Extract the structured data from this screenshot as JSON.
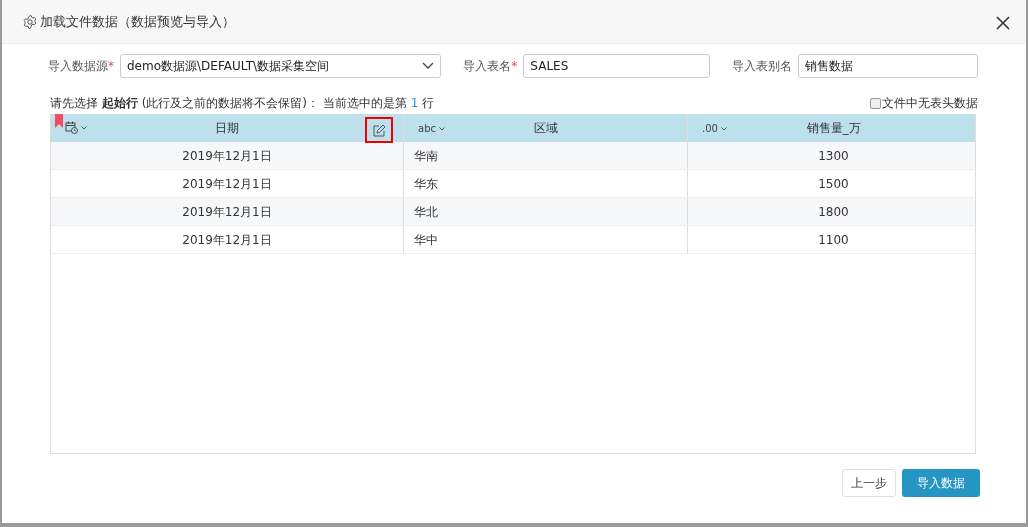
{
  "window": {
    "title": "加载文件数据（数据预览与导入）"
  },
  "form": {
    "fields": [
      {
        "label": "导入数据源",
        "required_mark": "*",
        "kind": "select",
        "value": "demo数据源\\DEFAULT\\数据采集空间"
      },
      {
        "label": "导入表名",
        "required_mark": "*",
        "kind": "input",
        "value": "SALES"
      },
      {
        "label": "导入表别名",
        "kind": "input",
        "value": "销售数据"
      }
    ]
  },
  "hint": {
    "text": "请先选择 **起始行** (此行及之前的数据将不会保留)： 当前选中的是第",
    "row_number": "1",
    "suffix": "行"
  },
  "no_header": {
    "label": "文件中无表头数据",
    "checked": false
  },
  "table": {
    "columns": [
      {
        "name": "日期",
        "kind": "date",
        "flagged": true,
        "edit_icon": true
      },
      {
        "name": "区域",
        "kind": "text",
        "type_label": "abc",
        "flagged": false,
        "edit_icon": false
      },
      {
        "name": "销售量_万",
        "kind": "number",
        "type_label": ".00",
        "flagged": false,
        "edit_icon": false
      }
    ],
    "rows": [
      [
        "2019年12月1日",
        "华南",
        "1300"
      ],
      [
        "2019年12月1日",
        "华东",
        "1500"
      ],
      [
        "2019年12月1日",
        "华北",
        "1800"
      ],
      [
        "2019年12月1日",
        "华中",
        "1100"
      ]
    ]
  },
  "buttons": [
    {
      "label": "上一步",
      "kind": "secondary"
    },
    {
      "label": "导入数据",
      "kind": "primary"
    }
  ]
}
